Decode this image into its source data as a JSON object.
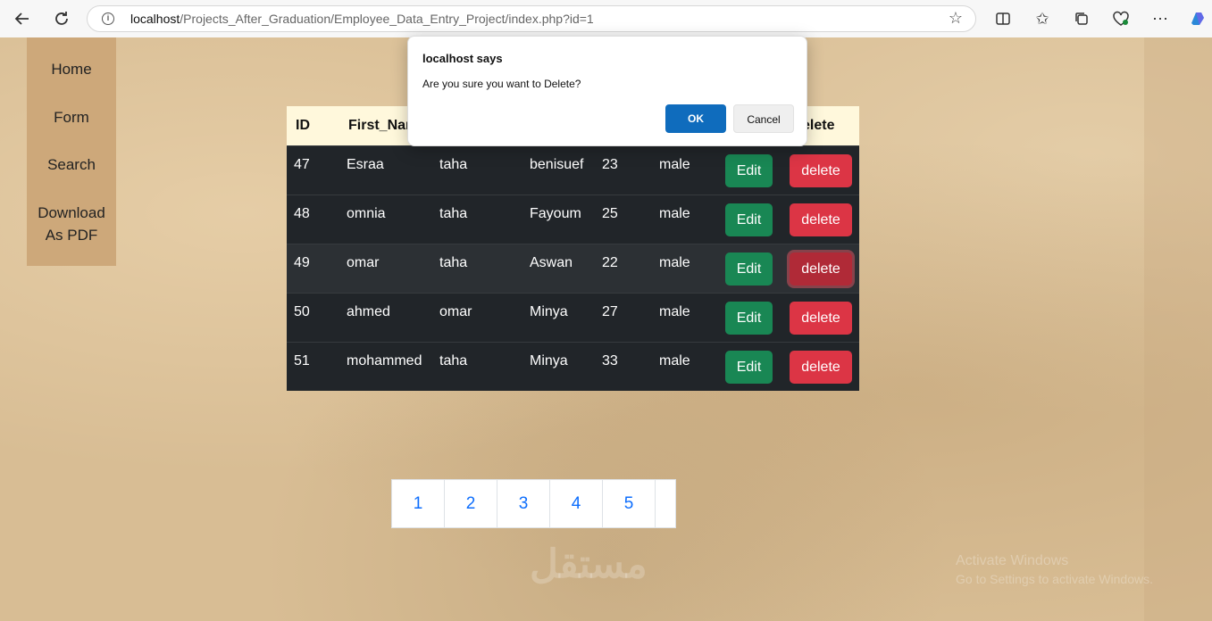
{
  "browser": {
    "url_host": "localhost",
    "url_path": "/Projects_After_Graduation/Employee_Data_Entry_Project/index.php?id=1"
  },
  "sidebar": {
    "items": [
      {
        "label": "Home"
      },
      {
        "label": "Form"
      },
      {
        "label": "Search"
      },
      {
        "label_line1": "Download",
        "label_line2": "As PDF"
      }
    ]
  },
  "table": {
    "headers": {
      "id": "ID",
      "first_name": "First_Nar",
      "delete": "elete"
    },
    "edit_label": "Edit",
    "delete_label": "delete",
    "rows": [
      {
        "id": "47",
        "first": "Esraa",
        "last": "taha",
        "city": "benisuef",
        "age": "23",
        "gender": "male"
      },
      {
        "id": "48",
        "first": "omnia",
        "last": "taha",
        "city": "Fayoum",
        "age": "25",
        "gender": "male"
      },
      {
        "id": "49",
        "first": "omar",
        "last": "taha",
        "city": "Aswan",
        "age": "22",
        "gender": "male"
      },
      {
        "id": "50",
        "first": "ahmed",
        "last": "omar",
        "city": "Minya",
        "age": "27",
        "gender": "male"
      },
      {
        "id": "51",
        "first": "mohammed",
        "last": "taha",
        "city": "Minya",
        "age": "33",
        "gender": "male"
      }
    ]
  },
  "pagination": {
    "pages": [
      "1",
      "2",
      "3",
      "4",
      "5"
    ]
  },
  "dialog": {
    "title": "localhost says",
    "message": "Are you sure you want to Delete?",
    "ok_label": "OK",
    "cancel_label": "Cancel"
  },
  "watermark": {
    "activate_line1": "Activate Windows",
    "activate_line2": "Go to Settings to activate Windows."
  },
  "colors": {
    "header_bg": "#fff8dc",
    "row_bg": "#212529",
    "edit": "#198754",
    "delete": "#dc3545",
    "sidebar": "#cda87a",
    "ok_button": "#0f6cbd"
  }
}
